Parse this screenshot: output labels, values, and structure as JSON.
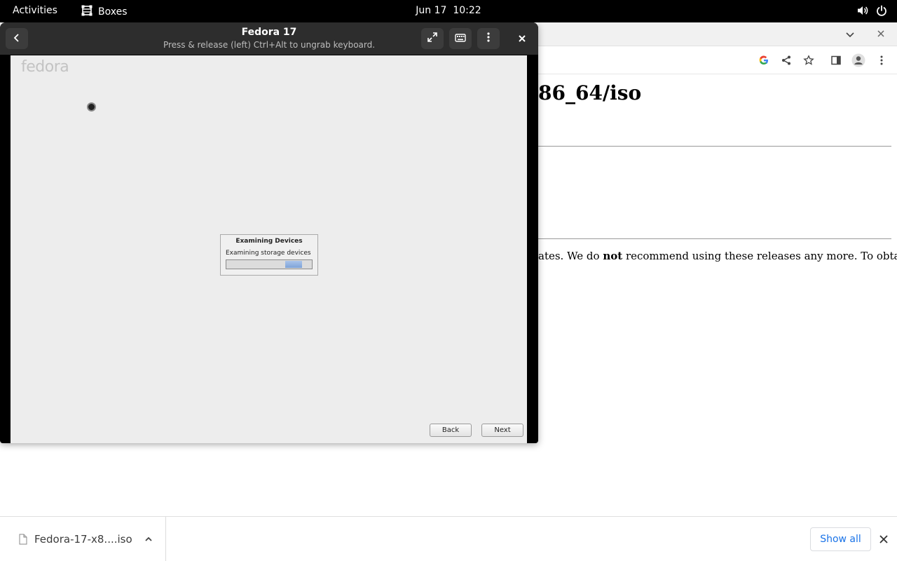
{
  "topbar": {
    "activities": "Activities",
    "app_name": "Boxes",
    "date": "Jun 17",
    "time": "10:22",
    "icons": [
      "boxes-app-icon",
      "volume-icon",
      "power-icon"
    ]
  },
  "boxes_window": {
    "title": "Fedora 17",
    "subtitle": "Press & release (left) Ctrl+Alt to ungrab keyboard.",
    "icons": [
      "back-arrow-icon",
      "fullscreen-icon",
      "keyboard-icon",
      "kebab-menu-icon",
      "close-icon"
    ]
  },
  "vm": {
    "logo": "fedora",
    "dialog": {
      "title": "Examining Devices",
      "message": "Examining storage devices",
      "progress_fraction": 0.2
    },
    "back_button": "Back",
    "next_button": "Next"
  },
  "browser": {
    "heading_fragment": "86_64/iso",
    "paragraph_start": "ates. We do ",
    "paragraph_bold": "not",
    "paragraph_end": " recommend using these releases any more. To obtain the",
    "accent_color": "#1a73e8"
  },
  "downloads": {
    "filename": "Fedora-17-x8....iso",
    "show_all": "Show all"
  }
}
